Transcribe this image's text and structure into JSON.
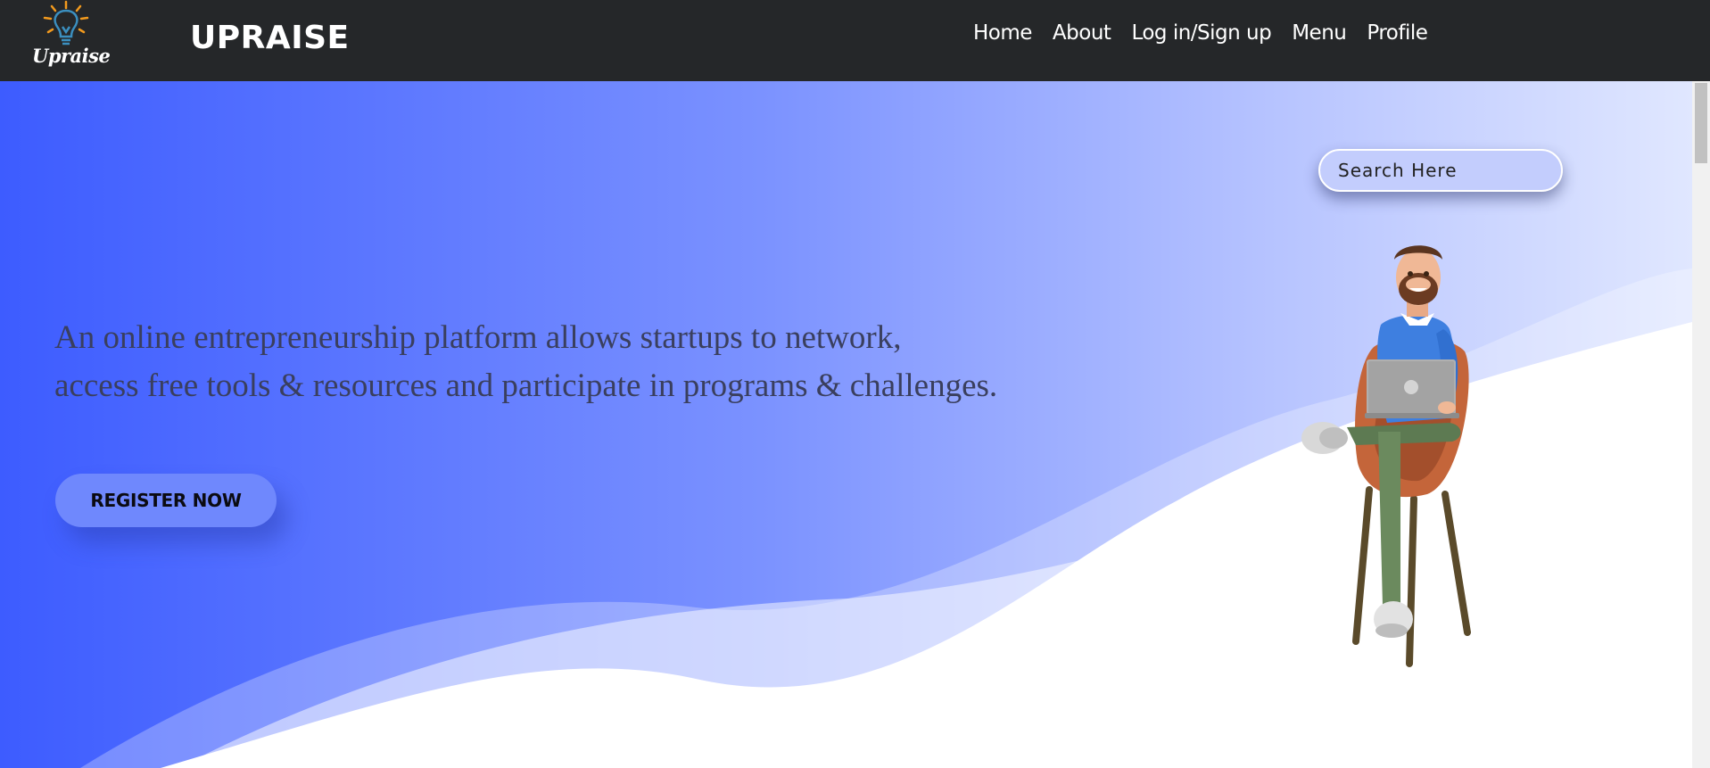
{
  "navbar": {
    "logo_text": "Upraise",
    "brand": "UPRAISE",
    "links": [
      "Home",
      "About",
      "Log in/Sign up",
      "Menu",
      "Profile"
    ]
  },
  "hero": {
    "search_placeholder": "Search Here",
    "tagline_line1": "An online entrepreneurship platform allows startups to network,",
    "tagline_line2": "access free tools & resources and participate in programs & challenges.",
    "register_label": "REGISTER NOW"
  },
  "icons": {
    "logo": "lightbulb-icon",
    "illustration": "man-sitting-with-laptop"
  },
  "colors": {
    "navbar": "#252729",
    "hero_gradient_start": "#3d5cff",
    "hero_gradient_end": "#e0e7ff",
    "logo_rays": "#f29a1e",
    "logo_bulb": "#3b8fbf"
  }
}
